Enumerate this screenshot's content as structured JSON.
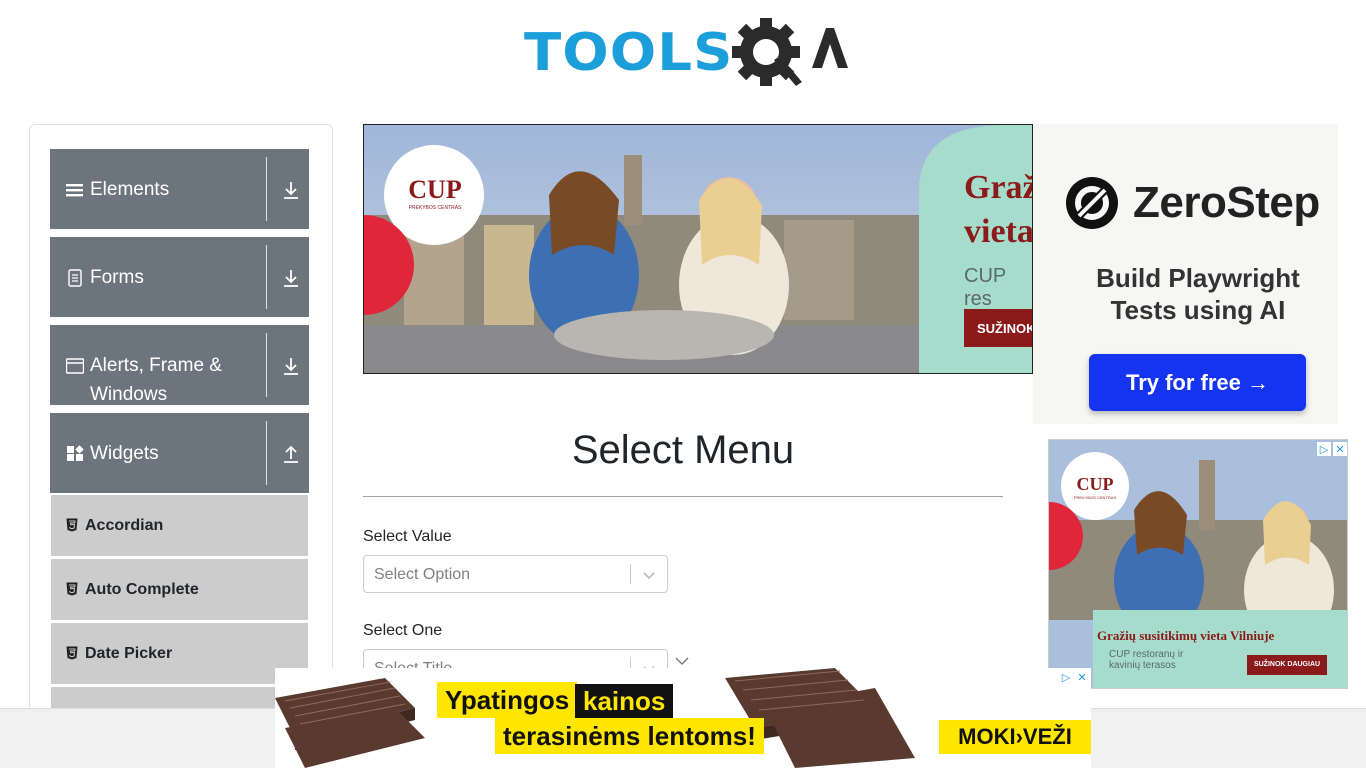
{
  "header": {
    "logo_text": "TOOLSQA"
  },
  "sidebar": {
    "groups": [
      {
        "label": "Elements",
        "icon": "list-icon",
        "arrow": "download-icon"
      },
      {
        "label": "Forms",
        "icon": "document-icon",
        "arrow": "download-icon"
      },
      {
        "label": "Alerts, Frame & Windows",
        "icon": "window-icon",
        "arrow": "download-icon"
      },
      {
        "label": "Widgets",
        "icon": "widgets-icon",
        "arrow": "upload-icon"
      }
    ],
    "items": [
      {
        "label": "Accordian",
        "icon": "html5-icon"
      },
      {
        "label": "Auto Complete",
        "icon": "html5-icon"
      },
      {
        "label": "Date Picker",
        "icon": "html5-icon"
      }
    ]
  },
  "main": {
    "title": "Select Menu",
    "fields": [
      {
        "label": "Select Value",
        "placeholder": "Select Option"
      },
      {
        "label": "Select One",
        "placeholder": "Select Title"
      }
    ]
  },
  "ads": {
    "banner": {
      "brand": "CUP",
      "brand_sub": "PREKYBOS CENTRAS",
      "headline_1": "Graž",
      "headline_2": "vieta",
      "sub": "CUP res",
      "button": "SUŽINOK"
    },
    "zerostep": {
      "name": "ZeroStep",
      "tagline_1": "Build Playwright",
      "tagline_2": "Tests using AI",
      "button": "Try for free →"
    },
    "cup_side": {
      "brand": "CUP",
      "brand_sub": "PREKYBOS CENTRAS",
      "headline": "Gražių susitikimų vieta Vilniuje",
      "sub_1": "CUP restoranų ir",
      "sub_2": "kavinių terasos",
      "button": "SUŽINOK DAUGIAU"
    },
    "bottom": {
      "line_1a": "Ypatingos",
      "line_1b": "kainos",
      "line_2": "terasinėms lentoms!",
      "brand": "MOKI›VEŽI"
    }
  },
  "colors": {
    "accent": "#1b9ed9",
    "sidebar_group": "#6c757d",
    "sidebar_item": "#cccccc",
    "cup_red": "#8b1a1a",
    "cup_mint": "#a6dccb",
    "zerostep_blue": "#1434f0"
  }
}
